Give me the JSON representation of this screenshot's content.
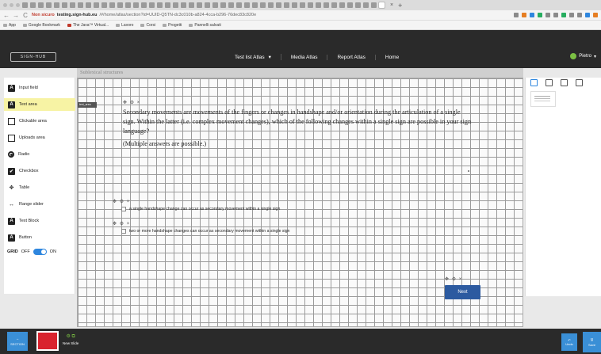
{
  "browser": {
    "tab_close": "×",
    "tab_new": "+",
    "nav": {
      "back": "←",
      "forward": "→",
      "reload": "C"
    },
    "url": {
      "security_label": "Non sicuro",
      "host": "testing.sign-hub.eu",
      "path": "/#/home/atlas/section?id=UUID-Q5TN-dc3c010b-a824-4cca-b296-76dec83c820e"
    },
    "bookmarks": [
      "App",
      "Google Bookmark",
      "The Java™ Virtual...",
      "Lavoro",
      "Corsi",
      "Progetti",
      "Pannelli salvati"
    ]
  },
  "header": {
    "logo_text": "SIGN-HUB",
    "nav": [
      {
        "label": "Test list Atlas",
        "has_dropdown": true,
        "caret": "▾"
      },
      {
        "label": "Media Atlas",
        "has_dropdown": false
      },
      {
        "label": "Report Atlas",
        "has_dropdown": false
      },
      {
        "label": "Home",
        "has_dropdown": false
      }
    ],
    "user": {
      "name": "Pietro",
      "caret": "▾"
    }
  },
  "subheader": {
    "title": "Sublexical structures"
  },
  "sidebar": {
    "items": [
      {
        "label": "Input field",
        "icon": "input-field-icon",
        "glyph": "A"
      },
      {
        "label": "Text area",
        "icon": "text-area-icon",
        "glyph": "A",
        "active": true
      },
      {
        "label": "Clickable area",
        "icon": "clickable-area-icon",
        "glyph": ""
      },
      {
        "label": "Uploads area",
        "icon": "upload-area-icon",
        "glyph": ""
      },
      {
        "label": "Radio",
        "icon": "radio-icon",
        "glyph": ""
      },
      {
        "label": "Checkbox",
        "icon": "checkbox-icon",
        "glyph": "✔"
      },
      {
        "label": "Table",
        "icon": "table-icon",
        "glyph": "✥"
      },
      {
        "label": "Range slider",
        "icon": "range-slider-icon",
        "glyph": "↔"
      },
      {
        "label": "Text Block",
        "icon": "text-block-icon",
        "glyph": "A"
      },
      {
        "label": "Button",
        "icon": "button-icon",
        "glyph": "A"
      }
    ],
    "grid_toggle": {
      "label": "GRID",
      "off": "OFF",
      "on": "ON",
      "state": "on"
    }
  },
  "canvas": {
    "tag_label": "text_area",
    "control_glyphs": "✥ ⚙ ×",
    "question": {
      "paragraph1": "Secondary movements are movements of the fingers or changes in handshape and/or orientation during the articulation of a single sign. Within the latter (i.e. complex movement changes), which of the following changes within a single sign are possible in your sign language?",
      "paragraph2": "(Multiple answers are possible.)"
    },
    "options": [
      "a single handshape change can occur as secondary movement within a single sign",
      "two or more handshape changes can occur as secondary movement within a single sign"
    ],
    "next_button": "Next"
  },
  "bottombar": {
    "section_label": "SECTION",
    "section_glyph": "↔",
    "new_slide_label": "New Slide",
    "new_slide_glyph": "⚙ ⧉",
    "undo_label": "Undo",
    "undo_glyph": "↶",
    "save_label": "Save",
    "save_glyph": "🖫"
  },
  "colors": {
    "header_bg": "#2a2a2a",
    "accent_blue": "#2c5aa0",
    "active_sidebar": "#f7f3a4",
    "slide_red": "#d9232e",
    "user_green": "#7bc043"
  }
}
